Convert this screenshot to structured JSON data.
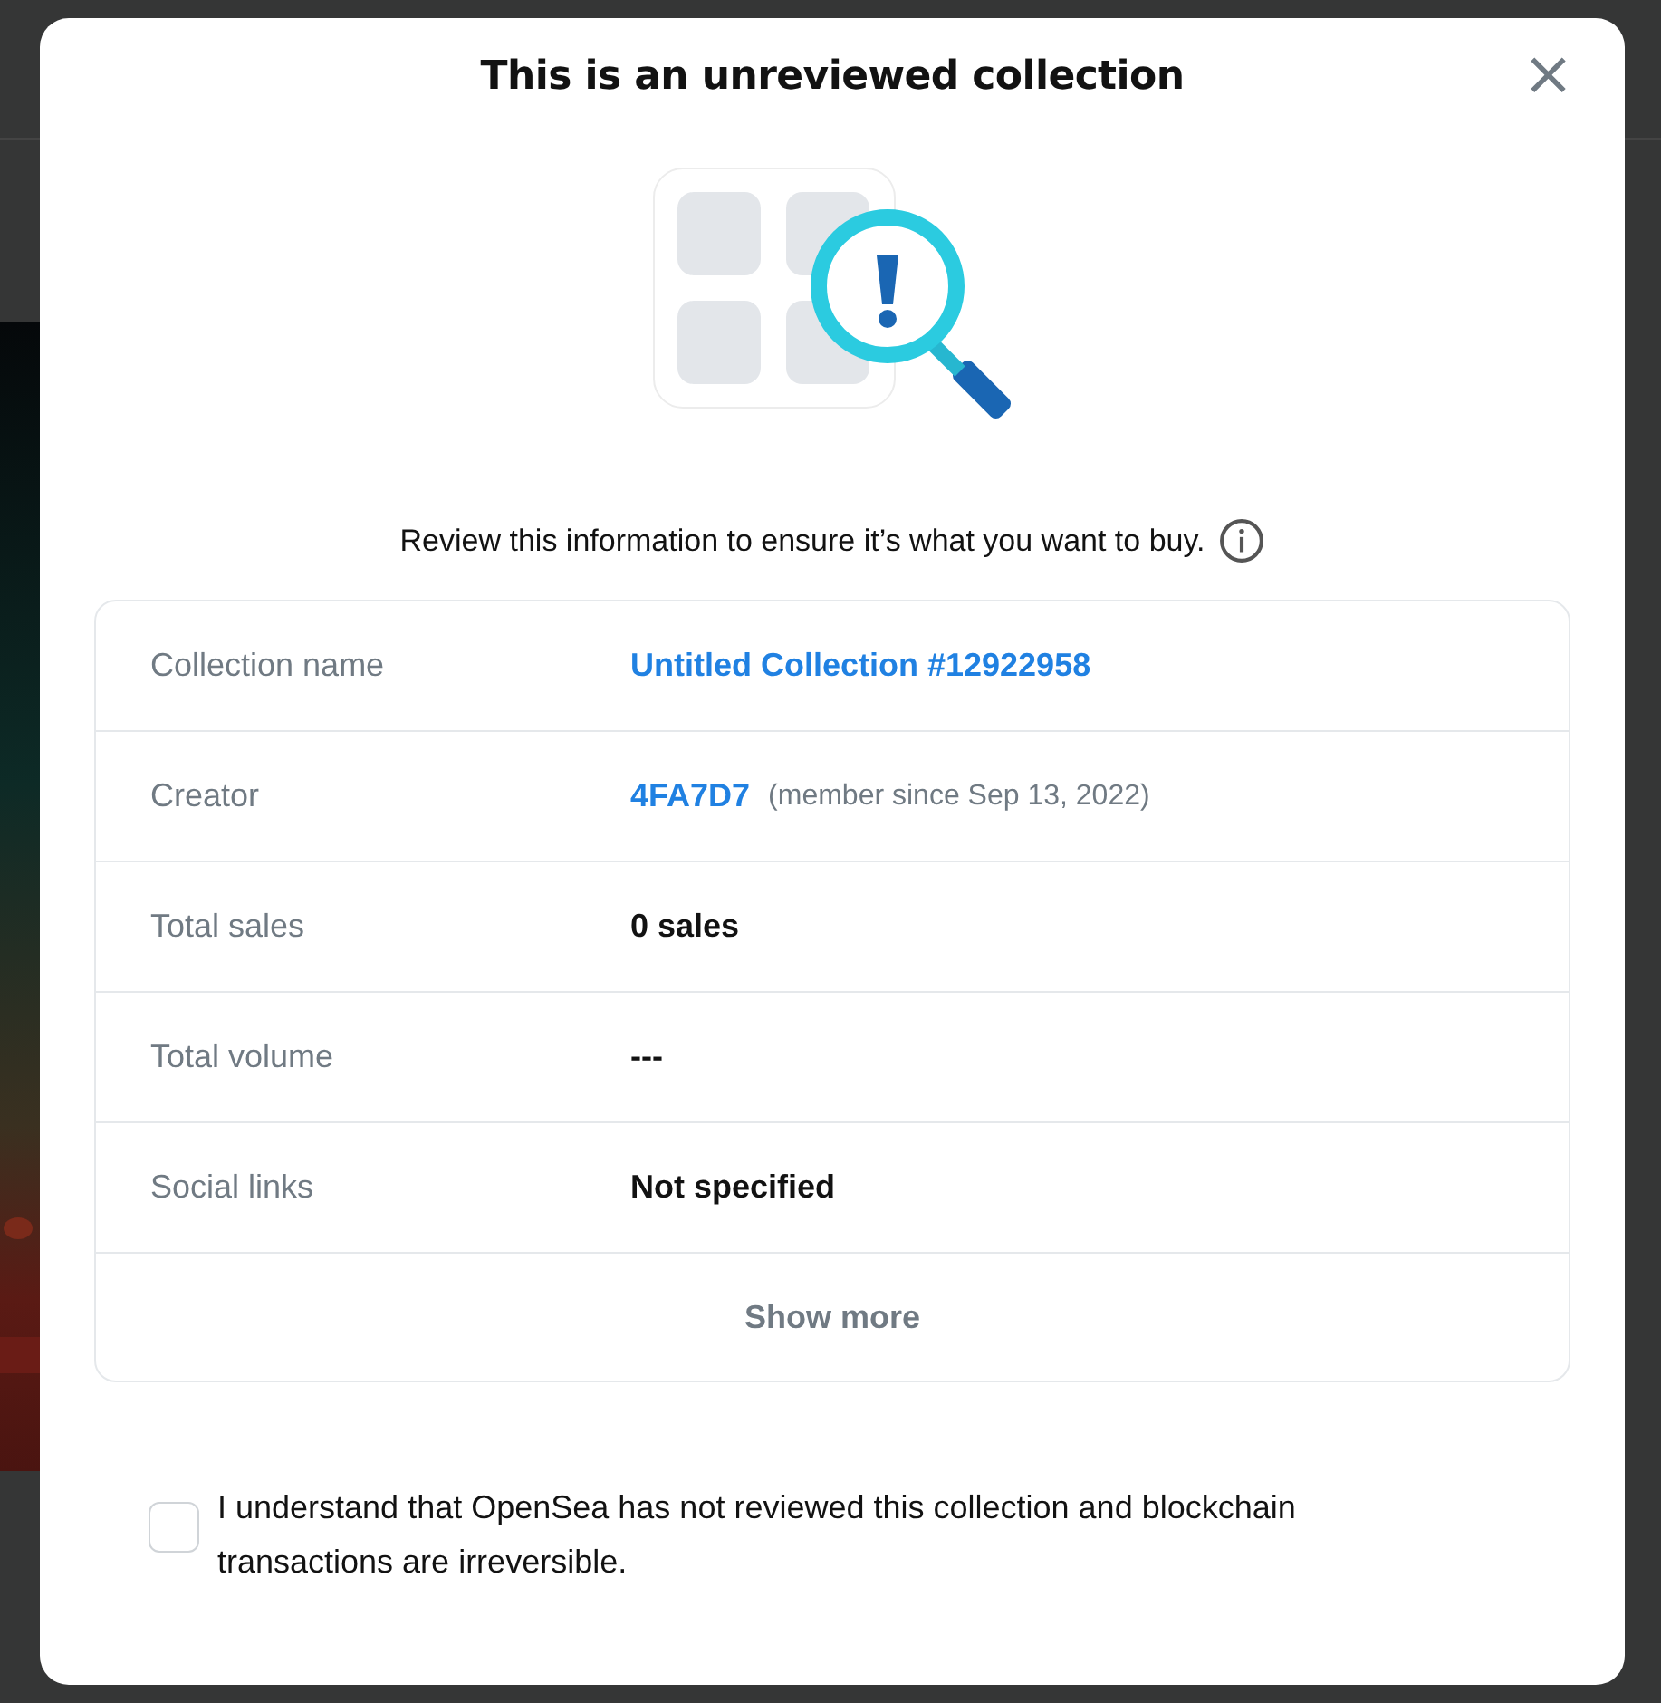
{
  "dialog": {
    "title": "This is an unreviewed collection",
    "close": "×",
    "message": "Review this information to ensure it’s what you want to buy.",
    "details": [
      {
        "label": "Collection name",
        "value": "Untitled Collection #12922958",
        "kind": "link"
      },
      {
        "label": "Creator",
        "value": "4FA7D7",
        "note": "(member since Sep 13, 2022)",
        "kind": "link"
      },
      {
        "label": "Total sales",
        "value": "0 sales",
        "kind": "text"
      },
      {
        "label": "Total volume",
        "value": "---",
        "kind": "text"
      },
      {
        "label": "Social links",
        "value": "Not specified",
        "kind": "text"
      }
    ],
    "show_more": "Show more",
    "consent": {
      "checked": false,
      "text": "I understand that OpenSea has not reviewed this collection and blockchain transactions are irreversible."
    }
  }
}
